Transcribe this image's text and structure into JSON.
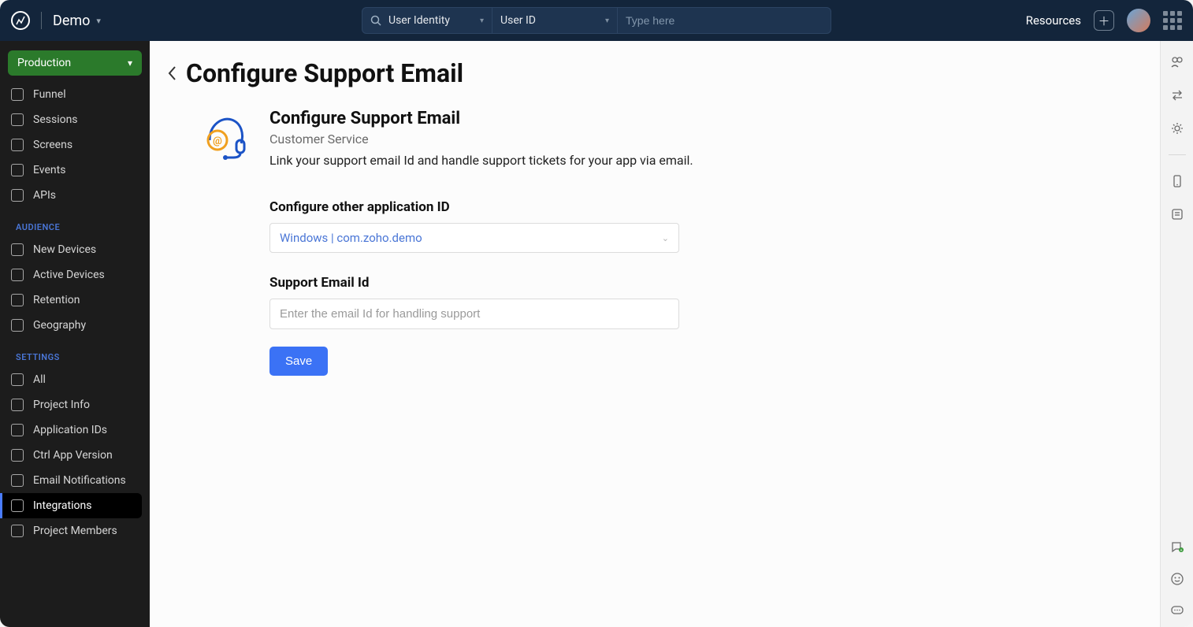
{
  "header": {
    "project_name": "Demo",
    "search_mode": "User Identity",
    "search_field": "User ID",
    "search_placeholder": "Type here",
    "resources_label": "Resources"
  },
  "sidebar": {
    "env_label": "Production",
    "groups": [
      {
        "title": null,
        "items": [
          {
            "label": "Funnel",
            "id": "funnel"
          },
          {
            "label": "Sessions",
            "id": "sessions"
          },
          {
            "label": "Screens",
            "id": "screens"
          },
          {
            "label": "Events",
            "id": "events"
          },
          {
            "label": "APIs",
            "id": "apis"
          }
        ]
      },
      {
        "title": "AUDIENCE",
        "items": [
          {
            "label": "New Devices",
            "id": "new-devices"
          },
          {
            "label": "Active Devices",
            "id": "active-devices"
          },
          {
            "label": "Retention",
            "id": "retention"
          },
          {
            "label": "Geography",
            "id": "geography"
          }
        ]
      },
      {
        "title": "SETTINGS",
        "items": [
          {
            "label": "All",
            "id": "all"
          },
          {
            "label": "Project Info",
            "id": "project-info"
          },
          {
            "label": "Application IDs",
            "id": "application-ids"
          },
          {
            "label": "Ctrl App Version",
            "id": "ctrl-app-version"
          },
          {
            "label": "Email Notifications",
            "id": "email-notifications"
          },
          {
            "label": "Integrations",
            "id": "integrations",
            "active": true
          },
          {
            "label": "Project Members",
            "id": "project-members"
          }
        ]
      }
    ]
  },
  "page": {
    "title": "Configure Support Email",
    "card_title": "Configure Support Email",
    "card_subtitle": "Customer Service",
    "card_description": "Link your support email Id and handle support tickets for your app via email.",
    "form": {
      "app_id_label": "Configure other application ID",
      "app_id_value": "Windows | com.zoho.demo",
      "email_label": "Support Email Id",
      "email_placeholder": "Enter the email Id for handling support",
      "save_label": "Save"
    }
  }
}
